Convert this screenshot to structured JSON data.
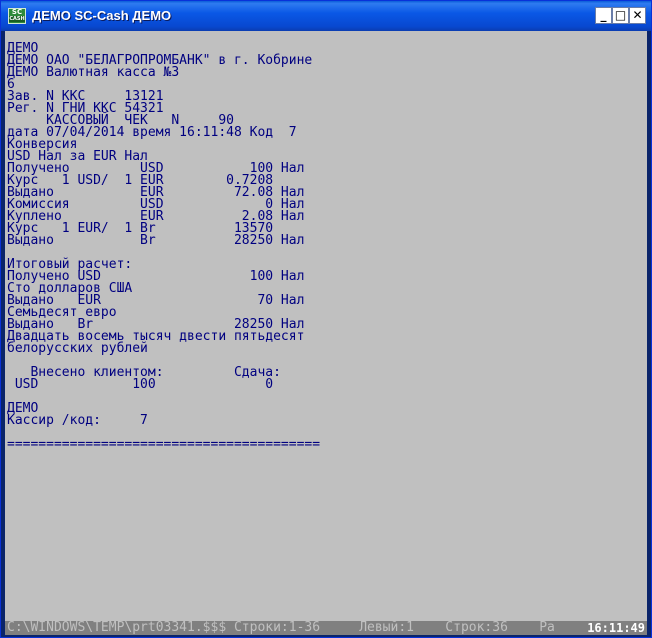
{
  "window": {
    "title": "ДЕМО SC-Cash ДЕМО",
    "icon_text_top": "SC",
    "icon_text_bottom": "CASH",
    "minimize_label": "_",
    "maximize_label": "□",
    "close_label": "✕"
  },
  "receipt": {
    "lines": [
      "ДЕМО",
      "ДЕМО ОАО \"БЕЛАГРОПРОМБАНК\" в г. Кобрине",
      "ДЕМО Валютная касса №3",
      "6",
      "Зав. N ККС     13121",
      "Рег. N ГНИ ККС 54321",
      "     КАССОВЫЙ  ЧЕК   N     90",
      "дата 07/04/2014 время 16:11:48 Код  7",
      "Конверсия",
      "USD Нал за EUR Нал",
      "Получено         USD           100 Нал",
      "Курс   1 USD/  1 EUR        0.7208",
      "Выдано           EUR         72.08 Нал",
      "Комиссия         USD             0 Нал",
      "Куплено          EUR          2.08 Нал",
      "Курс   1 EUR/  1 Br          13570",
      "Выдано           Br          28250 Нал",
      "",
      "Итоговый расчет:",
      "Получено USD                   100 Нал",
      "Сто долларов США",
      "Выдано   EUR                    70 Нал",
      "Семьдесят евро",
      "Выдано   Br                  28250 Нал",
      "Двадцать восемь тысяч двести пятьдесят",
      "белорусских рублей",
      "",
      "   Внесено клиентом:         Сдача:",
      " USD            100              0",
      "",
      "ДЕМО",
      "Кассир /код:     7",
      "",
      "========================================"
    ]
  },
  "status": {
    "text": "C:\\WINDOWS\\TEMP\\prt03341.$$$ Строки:1-36     Левый:1    Строк:36    Ра",
    "clock": "16:11:49"
  }
}
